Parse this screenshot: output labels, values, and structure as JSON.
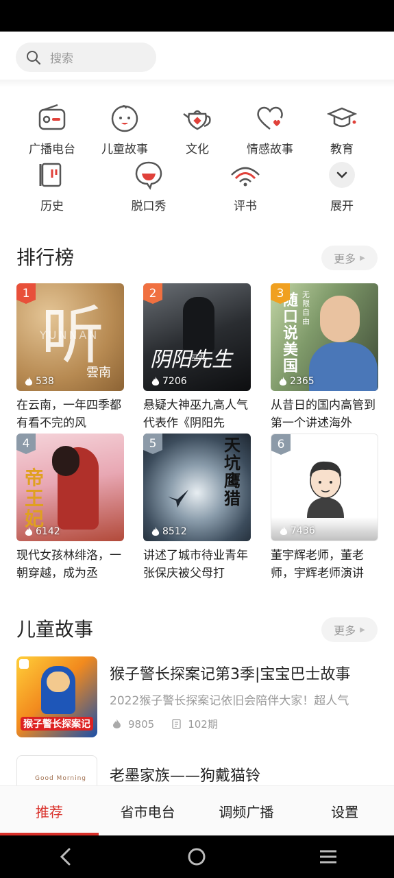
{
  "search": {
    "placeholder": "搜索"
  },
  "categories": [
    {
      "label": "广播电台",
      "icon": "radio-icon"
    },
    {
      "label": "儿童故事",
      "icon": "child-face-icon"
    },
    {
      "label": "文化",
      "icon": "teapot-icon"
    },
    {
      "label": "情感故事",
      "icon": "heart-icon"
    },
    {
      "label": "教育",
      "icon": "graduation-cap-icon"
    },
    {
      "label": "历史",
      "icon": "scroll-icon"
    },
    {
      "label": "脱口秀",
      "icon": "speech-bubble-icon"
    },
    {
      "label": "评书",
      "icon": "fan-icon"
    },
    {
      "label": "展开",
      "icon": "chevron-down-icon"
    }
  ],
  "ranking": {
    "title": "排行榜",
    "more": "更多",
    "items": [
      {
        "rank": "1",
        "plays": "538",
        "title": "在云南，一年四季都有看不完的风",
        "cover_text": "听",
        "cover_sub": "雲南",
        "cover_en": "YUNNAN"
      },
      {
        "rank": "2",
        "plays": "7206",
        "title": "悬疑大神巫九高人气代表作《阴阳先",
        "cover_text": "阴阳先生",
        "cover_sub": "巫九"
      },
      {
        "rank": "3",
        "plays": "2365",
        "title": "从昔日的国内高管到第一个讲述海外",
        "cover_text": "随口说美国",
        "cover_sub": "无限自由"
      },
      {
        "rank": "4",
        "plays": "6142",
        "title": "现代女孩林绯洛，一朝穿越，成为丞",
        "cover_text": "帝王妃"
      },
      {
        "rank": "5",
        "plays": "8512",
        "title": "讲述了城市待业青年张保庆被父母打",
        "cover_text": "天坑鹰猎"
      },
      {
        "rank": "6",
        "plays": "7436",
        "title": "董宇辉老师，董老师，宇辉老师演讲"
      }
    ]
  },
  "kids": {
    "title": "儿童故事",
    "more": "更多",
    "items": [
      {
        "title": "猴子警长探案记第3季|宝宝巴士故事",
        "desc": "2022猴子警长探案记依旧会陪伴大家！超人气",
        "plays": "9805",
        "episodes": "102期",
        "cover_text": "猴子警长探案记"
      },
      {
        "title": "老墨家族——狗戴猫铃",
        "cover_text": "Good Morning"
      }
    ]
  },
  "tabs": [
    "推荐",
    "省市电台",
    "调频广播",
    "设置"
  ],
  "colors": {
    "accent": "#d9302a",
    "rank1": "#e8503a",
    "rank2": "#f07040",
    "rank3": "#f0a020",
    "rank_other": "#8c9aa8"
  }
}
